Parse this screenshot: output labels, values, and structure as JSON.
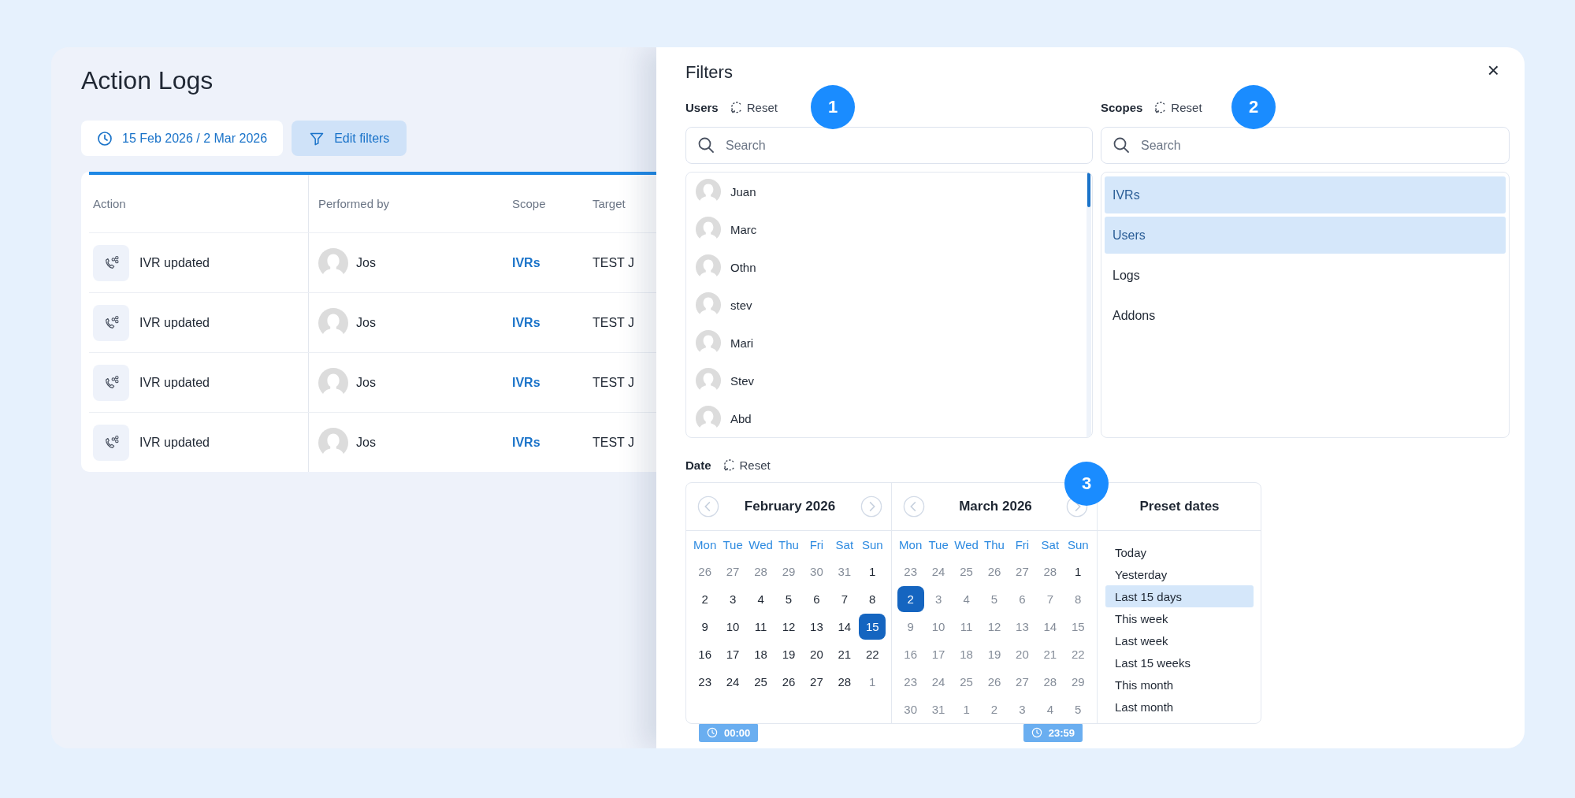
{
  "page": {
    "title": "Action Logs",
    "date_range": "15 Feb 2026 / 2 Mar 2026",
    "edit_filters": "Edit filters"
  },
  "table": {
    "columns": [
      "Action",
      "Performed by",
      "Scope",
      "Target"
    ],
    "rows": [
      {
        "action": "IVR updated",
        "performed_by": "Jos",
        "scope": "IVRs",
        "target": "TEST J"
      },
      {
        "action": "IVR updated",
        "performed_by": "Jos",
        "scope": "IVRs",
        "target": "TEST J"
      },
      {
        "action": "IVR updated",
        "performed_by": "Jos",
        "scope": "IVRs",
        "target": "TEST J"
      },
      {
        "action": "IVR updated",
        "performed_by": "Jos",
        "scope": "IVRs",
        "target": "TEST J"
      }
    ]
  },
  "filters": {
    "title": "Filters",
    "close": "×",
    "users": {
      "label": "Users",
      "reset": "Reset",
      "marker": "1",
      "search": {
        "placeholder": "Search"
      },
      "items": [
        {
          "name": "Juan"
        },
        {
          "name": "Marc"
        },
        {
          "name": "Othn"
        },
        {
          "name": "stev"
        },
        {
          "name": "Mari"
        },
        {
          "name": "Stev"
        },
        {
          "name": "Abd"
        }
      ]
    },
    "scopes": {
      "label": "Scopes",
      "reset": "Reset",
      "marker": "2",
      "search": {
        "placeholder": "Search"
      },
      "items": [
        {
          "label": "IVRs",
          "selected": true
        },
        {
          "label": "Users",
          "selected": true
        },
        {
          "label": "Logs",
          "selected": false
        },
        {
          "label": "Addons",
          "selected": false
        }
      ]
    },
    "date": {
      "label": "Date",
      "reset": "Reset",
      "marker": "3",
      "months": [
        {
          "title": "February 2026",
          "time": "00:00",
          "weekdays": [
            "Mon",
            "Tue",
            "Wed",
            "Thu",
            "Fri",
            "Sat",
            "Sun"
          ],
          "weeks": [
            [
              {
                "label": "26",
                "muted": true,
                "selected": false
              },
              {
                "label": "27",
                "muted": true,
                "selected": false
              },
              {
                "label": "28",
                "muted": true,
                "selected": false
              },
              {
                "label": "29",
                "muted": true,
                "selected": false
              },
              {
                "label": "30",
                "muted": true,
                "selected": false
              },
              {
                "label": "31",
                "muted": true,
                "selected": false
              },
              {
                "label": "1",
                "muted": false,
                "selected": false
              }
            ],
            [
              {
                "label": "2",
                "muted": false,
                "selected": false
              },
              {
                "label": "3",
                "muted": false,
                "selected": false
              },
              {
                "label": "4",
                "muted": false,
                "selected": false
              },
              {
                "label": "5",
                "muted": false,
                "selected": false
              },
              {
                "label": "6",
                "muted": false,
                "selected": false
              },
              {
                "label": "7",
                "muted": false,
                "selected": false
              },
              {
                "label": "8",
                "muted": false,
                "selected": false
              }
            ],
            [
              {
                "label": "9",
                "muted": false,
                "selected": false
              },
              {
                "label": "10",
                "muted": false,
                "selected": false
              },
              {
                "label": "11",
                "muted": false,
                "selected": false
              },
              {
                "label": "12",
                "muted": false,
                "selected": false
              },
              {
                "label": "13",
                "muted": false,
                "selected": false
              },
              {
                "label": "14",
                "muted": false,
                "selected": false
              },
              {
                "label": "15",
                "muted": false,
                "selected": true
              }
            ],
            [
              {
                "label": "16",
                "muted": false,
                "selected": false
              },
              {
                "label": "17",
                "muted": false,
                "selected": false
              },
              {
                "label": "18",
                "muted": false,
                "selected": false
              },
              {
                "label": "19",
                "muted": false,
                "selected": false
              },
              {
                "label": "20",
                "muted": false,
                "selected": false
              },
              {
                "label": "21",
                "muted": false,
                "selected": false
              },
              {
                "label": "22",
                "muted": false,
                "selected": false
              }
            ],
            [
              {
                "label": "23",
                "muted": false,
                "selected": false
              },
              {
                "label": "24",
                "muted": false,
                "selected": false
              },
              {
                "label": "25",
                "muted": false,
                "selected": false
              },
              {
                "label": "26",
                "muted": false,
                "selected": false
              },
              {
                "label": "27",
                "muted": false,
                "selected": false
              },
              {
                "label": "28",
                "muted": false,
                "selected": false
              },
              {
                "label": "1",
                "muted": true,
                "selected": false
              }
            ]
          ]
        },
        {
          "title": "March 2026",
          "time": "23:59",
          "weekdays": [
            "Mon",
            "Tue",
            "Wed",
            "Thu",
            "Fri",
            "Sat",
            "Sun"
          ],
          "weeks": [
            [
              {
                "label": "23",
                "muted": true,
                "selected": false
              },
              {
                "label": "24",
                "muted": true,
                "selected": false
              },
              {
                "label": "25",
                "muted": true,
                "selected": false
              },
              {
                "label": "26",
                "muted": true,
                "selected": false
              },
              {
                "label": "27",
                "muted": true,
                "selected": false
              },
              {
                "label": "28",
                "muted": true,
                "selected": false
              },
              {
                "label": "1",
                "muted": false,
                "selected": false
              }
            ],
            [
              {
                "label": "2",
                "muted": false,
                "selected": true
              },
              {
                "label": "3",
                "muted": true,
                "selected": false
              },
              {
                "label": "4",
                "muted": true,
                "selected": false
              },
              {
                "label": "5",
                "muted": true,
                "selected": false
              },
              {
                "label": "6",
                "muted": true,
                "selected": false
              },
              {
                "label": "7",
                "muted": true,
                "selected": false
              },
              {
                "label": "8",
                "muted": true,
                "selected": false
              }
            ],
            [
              {
                "label": "9",
                "muted": true,
                "selected": false
              },
              {
                "label": "10",
                "muted": true,
                "selected": false
              },
              {
                "label": "11",
                "muted": true,
                "selected": false
              },
              {
                "label": "12",
                "muted": true,
                "selected": false
              },
              {
                "label": "13",
                "muted": true,
                "selected": false
              },
              {
                "label": "14",
                "muted": true,
                "selected": false
              },
              {
                "label": "15",
                "muted": true,
                "selected": false
              }
            ],
            [
              {
                "label": "16",
                "muted": true,
                "selected": false
              },
              {
                "label": "17",
                "muted": true,
                "selected": false
              },
              {
                "label": "18",
                "muted": true,
                "selected": false
              },
              {
                "label": "19",
                "muted": true,
                "selected": false
              },
              {
                "label": "20",
                "muted": true,
                "selected": false
              },
              {
                "label": "21",
                "muted": true,
                "selected": false
              },
              {
                "label": "22",
                "muted": true,
                "selected": false
              }
            ],
            [
              {
                "label": "23",
                "muted": true,
                "selected": false
              },
              {
                "label": "24",
                "muted": true,
                "selected": false
              },
              {
                "label": "25",
                "muted": true,
                "selected": false
              },
              {
                "label": "26",
                "muted": true,
                "selected": false
              },
              {
                "label": "27",
                "muted": true,
                "selected": false
              },
              {
                "label": "28",
                "muted": true,
                "selected": false
              },
              {
                "label": "29",
                "muted": true,
                "selected": false
              }
            ],
            [
              {
                "label": "30",
                "muted": true,
                "selected": false
              },
              {
                "label": "31",
                "muted": true,
                "selected": false
              },
              {
                "label": "1",
                "muted": true,
                "selected": false
              },
              {
                "label": "2",
                "muted": true,
                "selected": false
              },
              {
                "label": "3",
                "muted": true,
                "selected": false
              },
              {
                "label": "4",
                "muted": true,
                "selected": false
              },
              {
                "label": "5",
                "muted": true,
                "selected": false
              }
            ]
          ]
        }
      ],
      "presets": {
        "title": "Preset dates",
        "items": [
          {
            "label": "Today",
            "selected": false
          },
          {
            "label": "Yesterday",
            "selected": false
          },
          {
            "label": "Last 15 days",
            "selected": true
          },
          {
            "label": "This week",
            "selected": false
          },
          {
            "label": "Last week",
            "selected": false
          },
          {
            "label": "Last 15 weeks",
            "selected": false
          },
          {
            "label": "This month",
            "selected": false
          },
          {
            "label": "Last month",
            "selected": false
          }
        ]
      }
    }
  }
}
